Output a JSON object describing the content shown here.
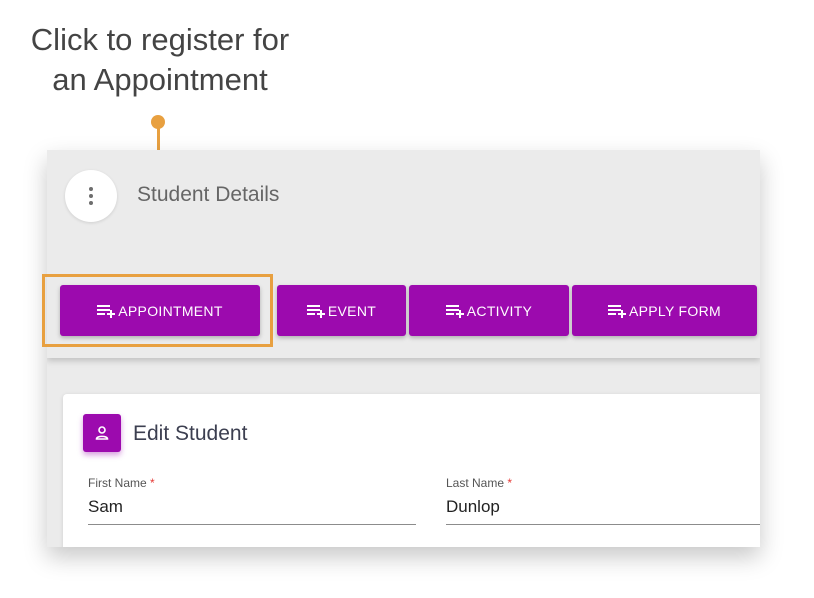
{
  "callout": {
    "line1": "Click to register for",
    "line2": "an Appointment"
  },
  "header": {
    "menu_icon": "more-vert-icon",
    "title": "Student Details"
  },
  "actions": [
    {
      "label": "APPOINTMENT",
      "icon": "playlist-add-icon"
    },
    {
      "label": "EVENT",
      "icon": "playlist-add-icon"
    },
    {
      "label": "ACTIVITY",
      "icon": "playlist-add-icon"
    },
    {
      "label": "APPLY FORM",
      "icon": "playlist-add-icon"
    }
  ],
  "form": {
    "title": "Edit Student",
    "icon": "person-icon",
    "first_name": {
      "label": "First Name",
      "required_mark": "*",
      "value": "Sam"
    },
    "last_name": {
      "label": "Last Name",
      "required_mark": "*",
      "value": "Dunlop"
    }
  },
  "colors": {
    "accent": "#9c0aae",
    "callout": "#e8a040",
    "required": "#e53935"
  }
}
